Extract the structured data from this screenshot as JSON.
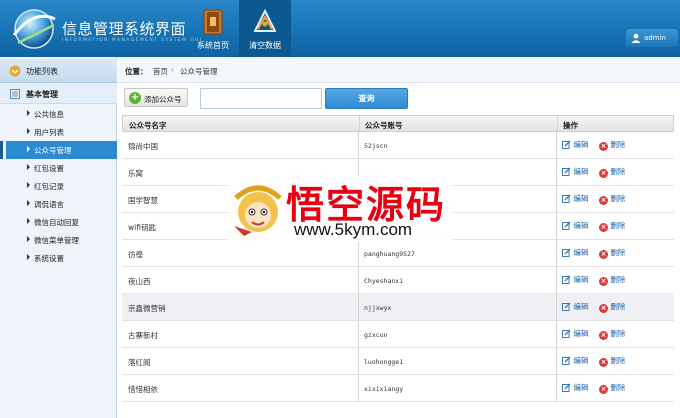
{
  "header": {
    "title": "信息管理系统界面",
    "subtitle": "INFORMATION MANAGEMENT SYSTEM GUI",
    "nav": [
      {
        "label": "系统首页",
        "icon": "book-icon"
      },
      {
        "label": "清空数据",
        "icon": "clear-data-icon"
      }
    ],
    "user": "admin",
    "colors": {
      "header": "#1773b3",
      "active_nav": "#0c5891"
    }
  },
  "sidebar": {
    "heading": "功能列表",
    "group": "基本管理",
    "items": [
      {
        "label": "公共信息"
      },
      {
        "label": "用户列表"
      },
      {
        "label": "公众号管理",
        "active": true
      },
      {
        "label": "红包设置"
      },
      {
        "label": "红包记录"
      },
      {
        "label": "调侃语言"
      },
      {
        "label": "微信自动回复"
      },
      {
        "label": "微信菜单管理"
      },
      {
        "label": "系统设置"
      }
    ]
  },
  "breadcrumb": {
    "label": "位置：",
    "home": "首页",
    "separator": "›",
    "current": "公众号管理"
  },
  "toolbar": {
    "add_label": "添加公众号",
    "search_value": "",
    "search_label": "查询"
  },
  "table": {
    "columns": [
      "公众号名字",
      "公众号账号",
      "操作"
    ],
    "edit_label": "编辑",
    "delete_label": "删除",
    "rows": [
      {
        "name": "锦尚中国",
        "account": "52jscn"
      },
      {
        "name": "乐窝",
        "account": ""
      },
      {
        "name": "国学智慧",
        "account": ""
      },
      {
        "name": "wifi钥匙",
        "account": ""
      },
      {
        "name": "彷徨",
        "account": "panghuang9527"
      },
      {
        "name": "夜山西",
        "account": "Chyeshanxi"
      },
      {
        "name": "京鑫微营销",
        "account": "njjxwyx"
      },
      {
        "name": "古寨新村",
        "account": "gzxcun"
      },
      {
        "name": "落红阁",
        "account": "luohongge1"
      },
      {
        "name": "惜惜相依",
        "account": "xixixiangy"
      }
    ]
  },
  "watermark": {
    "title": "悟空源码",
    "url": "www.5kym.com"
  }
}
